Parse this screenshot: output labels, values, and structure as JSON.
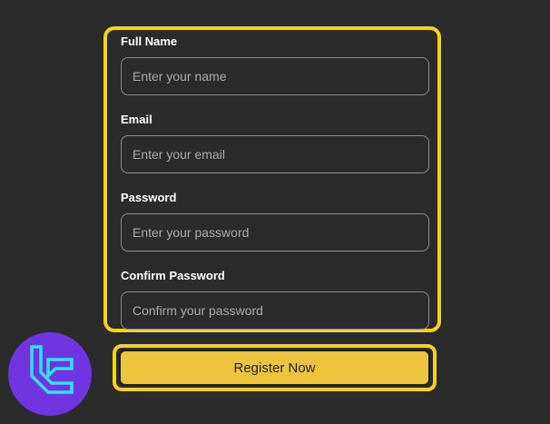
{
  "form": {
    "fields": [
      {
        "label": "Full Name",
        "placeholder": "Enter your name"
      },
      {
        "label": "Email",
        "placeholder": "Enter your email"
      },
      {
        "label": "Password",
        "placeholder": "Enter your password"
      },
      {
        "label": "Confirm Password",
        "placeholder": "Confirm your password"
      }
    ],
    "submit_label": "Register Now"
  },
  "colors": {
    "background": "#2b2b2b",
    "highlight": "#f5d21c",
    "button": "#eec43d",
    "logo_bg": "#6f35e0",
    "logo_glyph": "#2ee3f2"
  },
  "icons": {
    "logo": "brand-logo-icon"
  }
}
